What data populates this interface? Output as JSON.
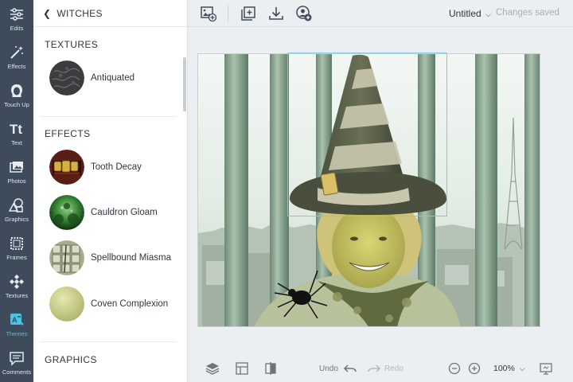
{
  "rail": [
    {
      "label": "Edits",
      "icon": "sliders-icon"
    },
    {
      "label": "Effects",
      "icon": "magic-wand-icon"
    },
    {
      "label": "Touch Up",
      "icon": "face-icon"
    },
    {
      "label": "Text",
      "icon": "text-icon"
    },
    {
      "label": "Photos",
      "icon": "photos-icon"
    },
    {
      "label": "Graphics",
      "icon": "shapes-icon"
    },
    {
      "label": "Frames",
      "icon": "frame-icon"
    },
    {
      "label": "Textures",
      "icon": "texture-icon"
    },
    {
      "label": "Themes",
      "icon": "themes-icon",
      "active": true
    },
    {
      "label": "Comments",
      "icon": "comment-icon"
    }
  ],
  "panel": {
    "back_label": "WITCHES",
    "sections": [
      {
        "title": "TEXTURES",
        "items": [
          {
            "label": "Antiquated"
          }
        ]
      },
      {
        "title": "EFFECTS",
        "items": [
          {
            "label": "Tooth Decay"
          },
          {
            "label": "Cauldron Gloam"
          },
          {
            "label": "Spellbound Miasma"
          },
          {
            "label": "Coven Complexion"
          }
        ]
      },
      {
        "title": "GRAPHICS",
        "items": []
      }
    ]
  },
  "topbar": {
    "doc_title": "Untitled",
    "save_status": "Changes saved"
  },
  "bottombar": {
    "undo_label": "Undo",
    "redo_label": "Redo",
    "zoom_level": "100%"
  },
  "colors": {
    "rail_bg": "#3d4b5b",
    "accent": "#45c4e6",
    "selection": "#7fc7e2"
  }
}
